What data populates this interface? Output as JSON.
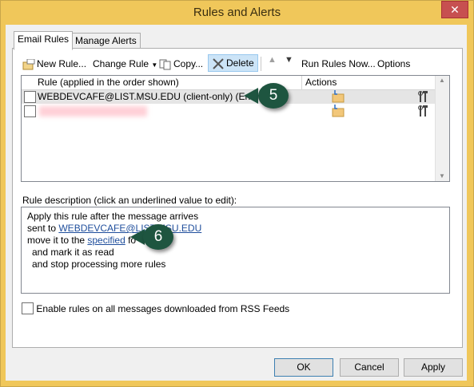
{
  "window": {
    "title": "Rules and Alerts",
    "close_glyph": "✕"
  },
  "tabs": [
    {
      "label": "Email Rules"
    },
    {
      "label": "Manage Alerts"
    }
  ],
  "toolbar": {
    "new_rule": "New Rule...",
    "change_rule": "Change Rule",
    "copy": "Copy...",
    "delete": "Delete",
    "move_up_glyph": "▲",
    "move_down_glyph": "▼",
    "run_rules_now": "Run Rules Now...",
    "options": "Options"
  },
  "rules_list": {
    "col_rule": "Rule (applied in the order shown)",
    "col_actions": "Actions",
    "rows": [
      {
        "name": "WEBDEVCAFE@LIST.MSU.EDU  (client-only)  (Error)",
        "checked": false,
        "selected": true
      },
      {
        "name": "",
        "checked": false,
        "selected": false
      }
    ]
  },
  "description": {
    "label": "Rule description (click an underlined value to edit):",
    "line1": "Apply this rule after the message arrives",
    "line2_prefix": "sent to ",
    "line2_link": "WEBDEVCAFE@LIST.MSU.EDU",
    "line3_prefix": "move it to the ",
    "line3_link": "specified",
    "line3_suffix": " fo",
    "line4": "and mark it as read",
    "line5": "and stop processing more rules"
  },
  "rss_option": {
    "label": "Enable rules on all messages downloaded from RSS Feeds",
    "checked": false
  },
  "buttons": {
    "ok": "OK",
    "cancel": "Cancel",
    "apply": "Apply"
  },
  "callouts": {
    "c5": "5",
    "c6": "6"
  },
  "colors": {
    "title_bar": "#f0c75a",
    "selection": "#e5e5e5",
    "callout": "#1e5540",
    "link": "#1f4e9c"
  }
}
